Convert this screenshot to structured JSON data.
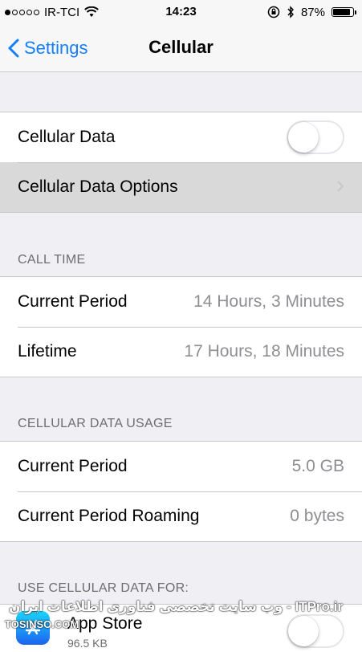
{
  "status_bar": {
    "carrier": "IR-TCI",
    "time": "14:23",
    "battery": "87%",
    "battery_level": 0.87,
    "signal_bars_filled": 1,
    "signal_bars_total": 5
  },
  "nav": {
    "back_label": "Settings",
    "title": "Cellular"
  },
  "cellular": {
    "data_label": "Cellular Data",
    "data_on": false,
    "options_label": "Cellular Data Options"
  },
  "call_time": {
    "header": "CALL TIME",
    "rows": [
      {
        "label": "Current Period",
        "value": "14 Hours, 3 Minutes"
      },
      {
        "label": "Lifetime",
        "value": "17 Hours, 18 Minutes"
      }
    ]
  },
  "data_usage": {
    "header": "CELLULAR DATA USAGE",
    "rows": [
      {
        "label": "Current Period",
        "value": "5.0 GB"
      },
      {
        "label": "Current Period Roaming",
        "value": "0 bytes"
      }
    ]
  },
  "use_for": {
    "header": "USE CELLULAR DATA FOR:",
    "apps": [
      {
        "name": "App Store",
        "size": "96.5 KB"
      }
    ]
  },
  "watermark": {
    "left": "TOSINSO.COM",
    "right": "ITPro.ir - وب سایت تخصصی فناوری اطلاعات ایران"
  },
  "colors": {
    "accent": "#147efb",
    "background": "#efeff4",
    "secondary_text": "#8e8e93"
  },
  "icons": {
    "wifi": "wifi-icon",
    "rotation_lock": "rotation-lock-icon",
    "bluetooth": "bluetooth-icon",
    "battery": "battery-icon",
    "back": "chevron-left-icon",
    "disclosure": "chevron-right-icon",
    "app_store": "app-store-icon"
  }
}
